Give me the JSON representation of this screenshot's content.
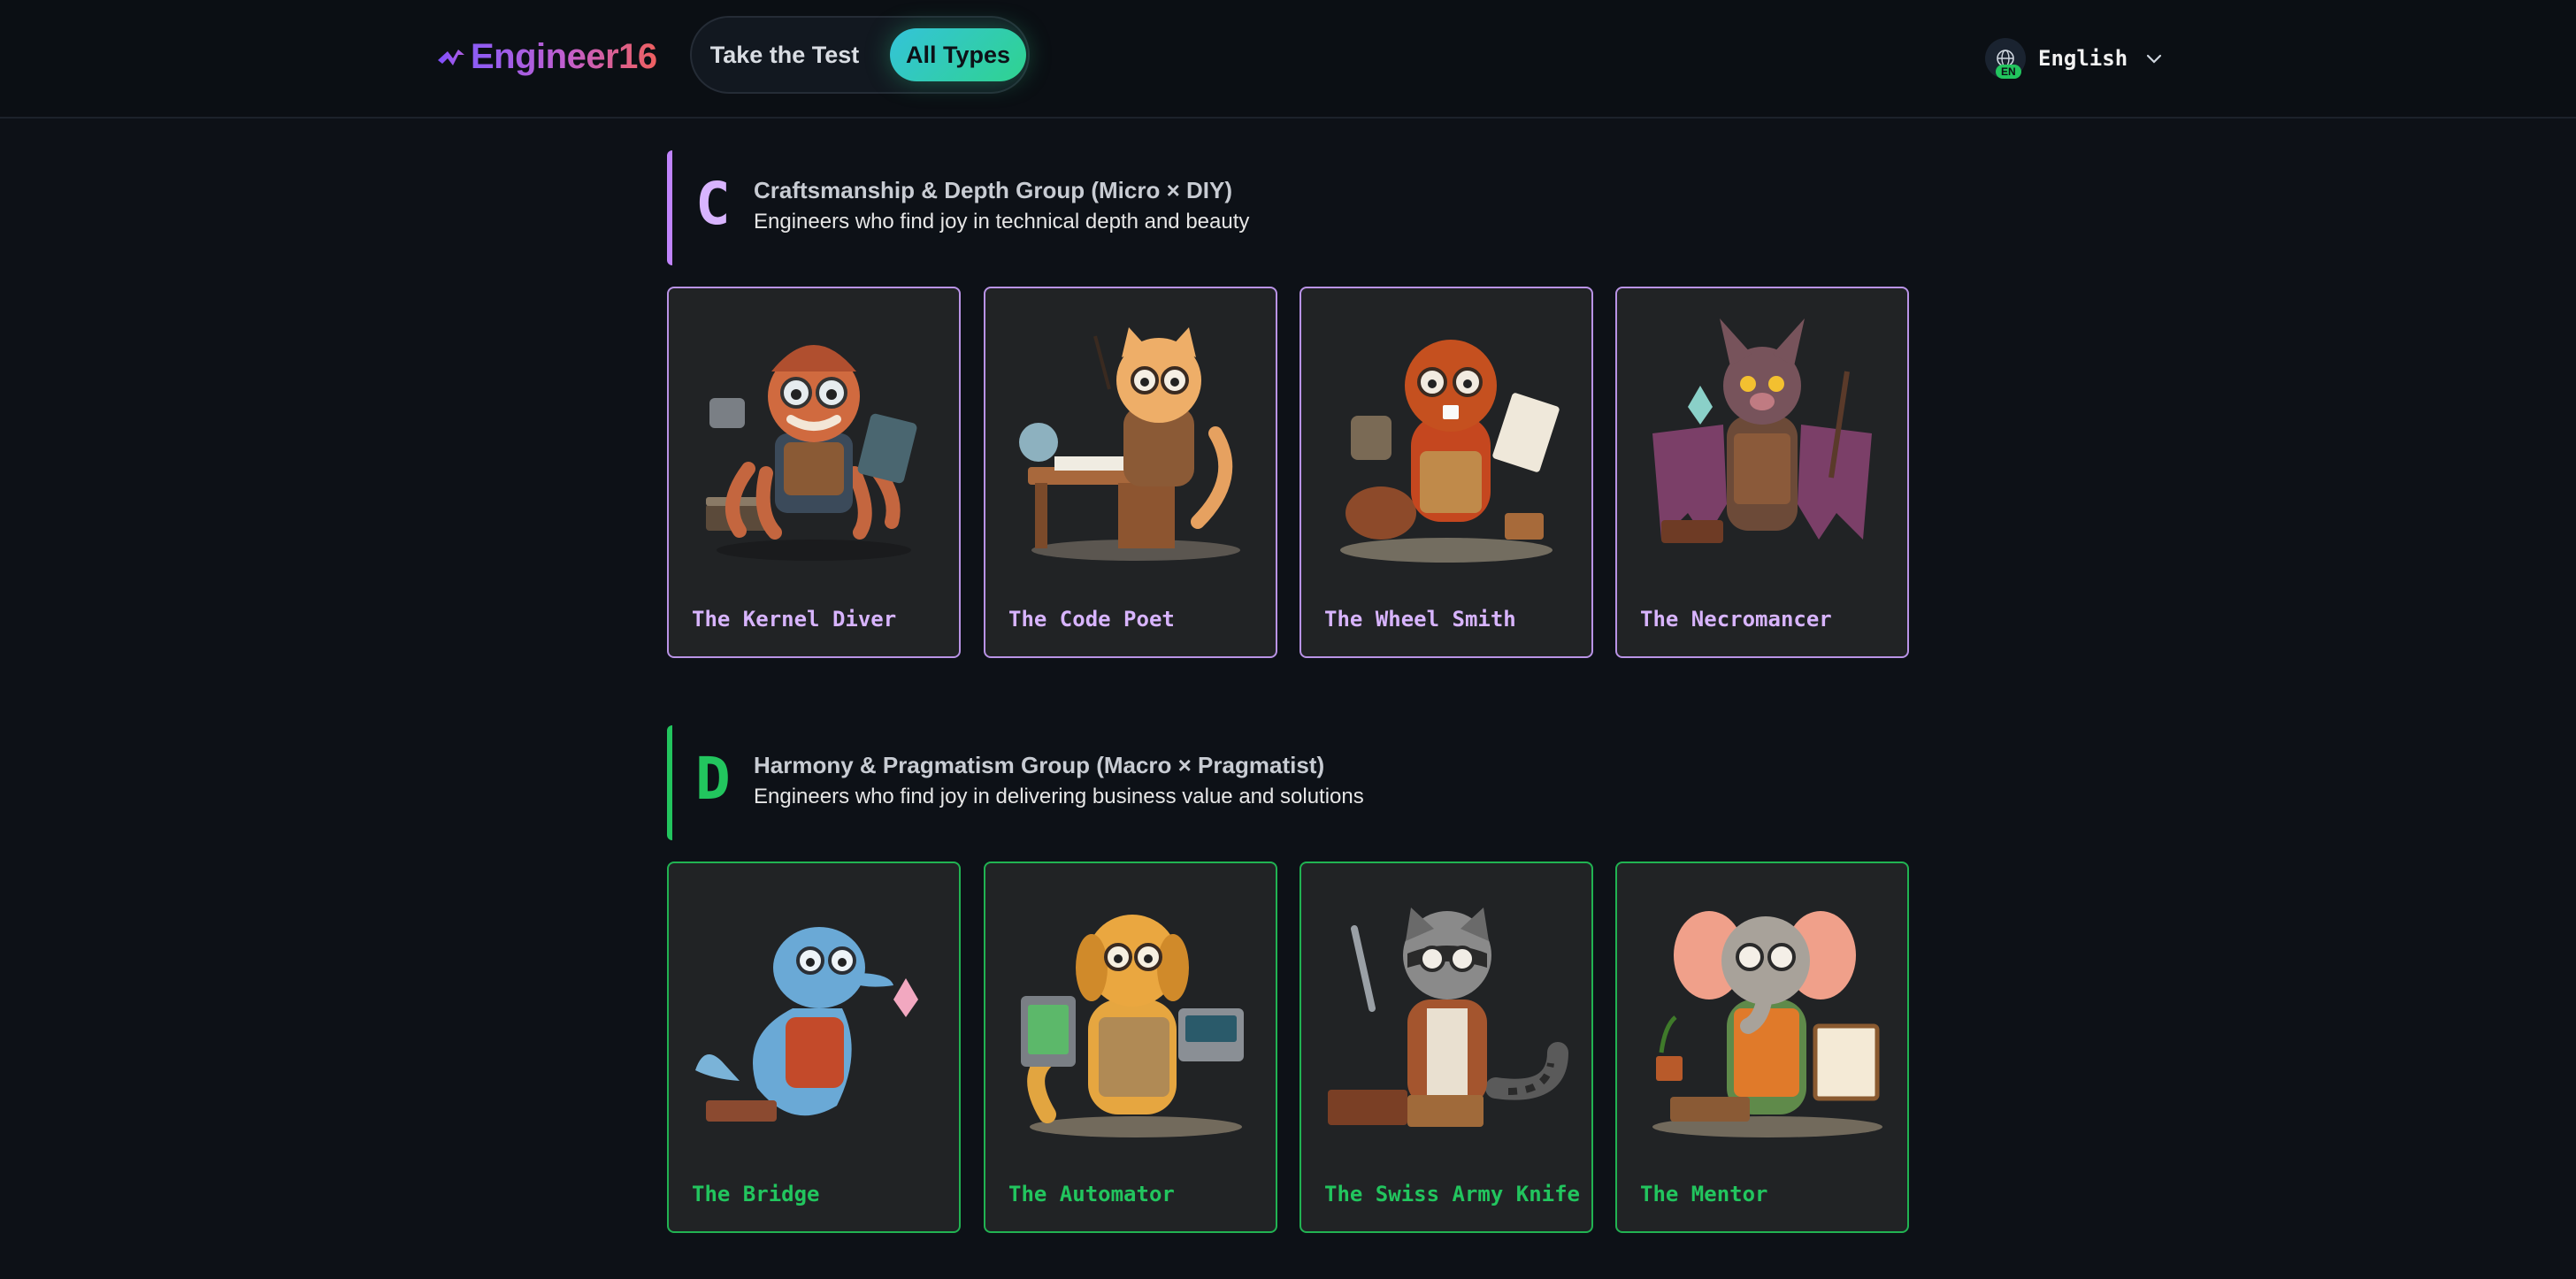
{
  "header": {
    "logo_text": "Engineer16",
    "nav": {
      "take_test": "Take the Test",
      "all_types": "All Types"
    },
    "language": {
      "label": "English",
      "badge": "EN"
    }
  },
  "groups": [
    {
      "letter": "C",
      "title": "Craftsmanship & Depth Group (Micro × DIY)",
      "description": "Engineers who find joy in technical depth and beauty",
      "accent": "#d8b4fe",
      "types": [
        {
          "name": "The Kernel Diver",
          "icon": "octopus-engineer-illustration"
        },
        {
          "name": "The Code Poet",
          "icon": "cat-writer-illustration"
        },
        {
          "name": "The Wheel Smith",
          "icon": "beaver-smith-illustration"
        },
        {
          "name": "The Necromancer",
          "icon": "bat-wizard-illustration"
        }
      ]
    },
    {
      "letter": "D",
      "title": "Harmony & Pragmatism Group (Macro × Pragmatist)",
      "description": "Engineers who find joy in delivering business value and solutions",
      "accent": "#22c55e",
      "types": [
        {
          "name": "The Bridge",
          "icon": "dolphin-illustration"
        },
        {
          "name": "The Automator",
          "icon": "golden-retriever-illustration"
        },
        {
          "name": "The Swiss Army Knife",
          "icon": "raccoon-illustration"
        },
        {
          "name": "The Mentor",
          "icon": "elephant-mentor-illustration"
        }
      ]
    }
  ]
}
